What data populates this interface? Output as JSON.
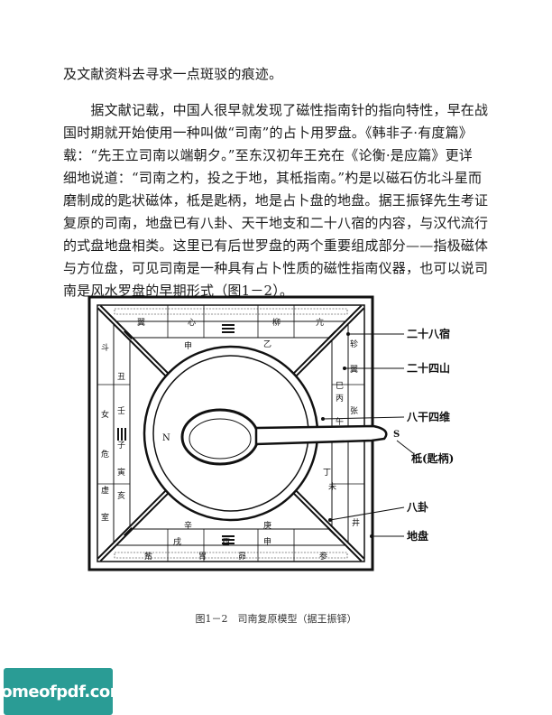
{
  "document": {
    "lines": [
      "及文献资料去寻求一点斑驳的痕迹。",
      "　　据文献记载，中国人很早就发现了磁性指南针的指向特性，早在战",
      "国时期就开始使用一种叫做“司南”的占卜用罗盘。《韩非子·有度篇》",
      "载：“先王立司南以端朝夕。”至东汉初年王充在《论衡·是应篇》更详",
      "细地说道：“司南之杓，投之于地，其柢指南。”杓是以磁石仿北斗星而",
      "磨制成的匙状磁体，柢是匙柄，地是占卜盘的地盘。据王振铎先生考证",
      "复原的司南，地盘已有八卦、天干地支和二十八宿的内容，与汉代流行",
      "的式盘地盘相类。这里已有后世罗盘的两个重要组成部分——指极磁体",
      "与方位盘，可见司南是一种具有占卜性质的磁性指南仪器，也可以说司",
      "南是风水罗盘的早期形式（图1－2）。"
    ]
  },
  "figure": {
    "labels": {
      "lunar_mansions": "二十八宿",
      "twenty_four_mountains": "二十四山",
      "eight_stems_four_corners": "八干四维",
      "handle": "柢(匙柄)",
      "bagua": "八卦",
      "earth_plate": "地盘"
    },
    "letters": {
      "north": "N",
      "south": "S"
    },
    "plate_chars": {
      "top_outer": [
        "翼",
        "心",
        "柳",
        "亢"
      ],
      "top_inner": [
        "申",
        "乙"
      ],
      "right_outer": [
        "轸",
        "翼",
        "张"
      ],
      "right_inner": [
        "丙",
        "巳",
        "午",
        "丁",
        "未"
      ],
      "bottom_outer": [
        "觜",
        "参",
        "井",
        "昴",
        "胃"
      ],
      "bottom_inner": [
        "辛",
        "庚",
        "戌",
        "酉",
        "申"
      ],
      "left_outer": [
        "斗",
        "女",
        "虚",
        "危",
        "室"
      ],
      "left_inner": [
        "丑",
        "寅",
        "亥",
        "壬",
        "子"
      ]
    },
    "caption": "图1－2　司南复原模型（据王振铎）"
  },
  "watermark": {
    "text": "homeofpdf.com",
    "color": "#2a9c95"
  }
}
